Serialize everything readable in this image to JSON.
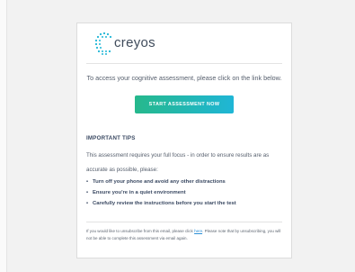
{
  "brand": {
    "logo_text": "creyos",
    "color": "#1fb6d6"
  },
  "email": {
    "intro": "To access your cognitive assessment, please click on the link below.",
    "cta_label": "START ASSESSMENT NOW",
    "cta_colors": [
      "#26b88c",
      "#1fb6d6"
    ],
    "tips_heading": "IMPORTANT TIPS",
    "tips_text": "This assessment requires your full focus - in order to ensure results are as accurate as possible, please:",
    "bullets": [
      {
        "label": "Turn off your phone and avoid any other distractions"
      },
      {
        "label": "Ensure you're in a quiet environment"
      },
      {
        "label": "Carefully review the instructions before you start the test"
      }
    ],
    "footer_pre": "If you would like to unsubscribe from this email, please click ",
    "footer_link": "here",
    "footer_post": ". Please note that by unsubscribing, you will not be able to complete this assessment via email again."
  }
}
